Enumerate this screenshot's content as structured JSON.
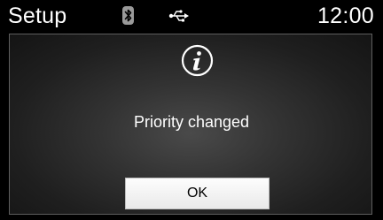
{
  "status_bar": {
    "title": "Setup",
    "clock": "12:00",
    "icons": [
      "bluetooth-icon",
      "usb-icon"
    ]
  },
  "dialog": {
    "icon": "info-icon",
    "message": "Priority changed",
    "ok_label": "OK"
  },
  "colors": {
    "background": "#000000",
    "text": "#ffffff",
    "button_background": "#f5f5f5",
    "button_text": "#000000"
  }
}
